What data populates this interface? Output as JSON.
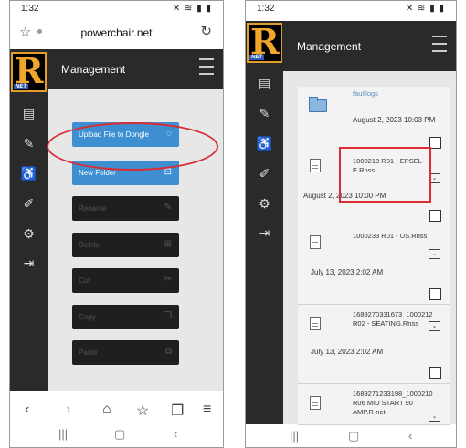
{
  "left": {
    "status": {
      "time": "1:32",
      "icons": "✕ ≋ ▮ ▮"
    },
    "browser": {
      "url": "powerchair.net"
    },
    "header": {
      "title": "Management"
    },
    "menu": [
      {
        "label": "Upload File to Dongle",
        "icon": "upload-icon",
        "active": true
      },
      {
        "label": "New Folder",
        "icon": "new-folder-icon",
        "active": true
      },
      {
        "label": "Rename",
        "icon": "pencil-icon",
        "active": false
      },
      {
        "label": "Delete",
        "icon": "trash-icon",
        "active": false
      },
      {
        "label": "Cut",
        "icon": "cut-icon",
        "active": false
      },
      {
        "label": "Copy",
        "icon": "copy-icon",
        "active": false
      },
      {
        "label": "Paste",
        "icon": "paste-icon",
        "active": false
      }
    ]
  },
  "right": {
    "status": {
      "time": "1:32",
      "icons": "✕ ≋ ▮ ▮"
    },
    "header": {
      "title": "Management"
    },
    "files": [
      {
        "name": "faultlogs",
        "date": "August 2, 2023 10:03 PM",
        "type": "folder"
      },
      {
        "name": "1000218 R01 - EPSEL-E.Rnss",
        "date": "August 2, 2023 10:00 PM",
        "type": "file"
      },
      {
        "name": "1000233 R01 - US.Rnss",
        "date": "July 13, 2023 2:02 AM",
        "type": "file"
      },
      {
        "name": "1689270331673_1000212 R02 - SEATING.Rnss",
        "date": "July 13, 2023 2:02 AM",
        "type": "file"
      },
      {
        "name": "1689271233198_1000210 R06 MID START 90 AMP.R-net",
        "date": "",
        "type": "file"
      }
    ]
  },
  "colors": {
    "accent": "#3d8fd1",
    "highlight": "#d92c33",
    "logo": "#f0a52d",
    "sidebar": "#2a2a2a"
  }
}
